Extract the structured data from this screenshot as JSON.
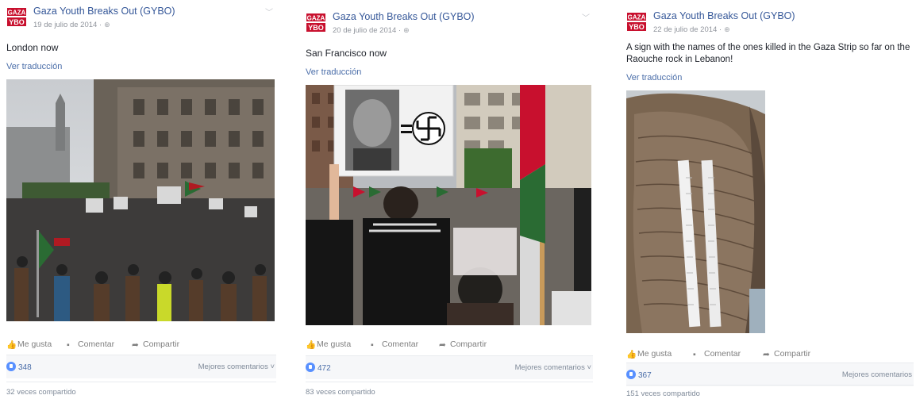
{
  "posts": [
    {
      "author": "Gaza Youth Breaks Out (GYBO)",
      "date": "19 de julio de 2014 ·",
      "text": "London now",
      "translate": "Ver traducción",
      "actions": {
        "like": "Me gusta",
        "comment": "Comentar",
        "share": "Compartir"
      },
      "likes": "348",
      "best_comments": "Mejores comentarios ˅",
      "shares": "32 veces compartido",
      "photo": "crowd-protest-london"
    },
    {
      "author": "Gaza Youth Breaks Out (GYBO)",
      "date": "20 de julio de 2014 ·",
      "text": "San Francisco now",
      "translate": "Ver traducción",
      "actions": {
        "like": "Me gusta",
        "comment": "Comentar",
        "share": "Compartir"
      },
      "likes": "472",
      "best_comments": "Mejores comentarios ˅",
      "shares": "83 veces compartido",
      "photo": "protest-sign-san-francisco"
    },
    {
      "author": "Gaza Youth Breaks Out (GYBO)",
      "date": "22 de julio de 2014 ·",
      "text_line1": "A sign with the names of the ones killed in the Gaza Strip so far on the",
      "text_line2": "Raouche rock in Lebanon!",
      "translate": "Ver traducción",
      "actions": {
        "like": "Me gusta",
        "comment": "Comentar",
        "share": "Compartir"
      },
      "likes": "367",
      "best_comments": "Mejores comentarios",
      "shares": "151 veces compartido",
      "photo": "raouche-rock-banners"
    }
  ],
  "logo": {
    "line1": "GAZA",
    "line2": "YBO",
    "color": "#c8102e"
  },
  "colors": {
    "link": "#365899",
    "muted": "#90949c",
    "like_blue": "#5890ff"
  }
}
